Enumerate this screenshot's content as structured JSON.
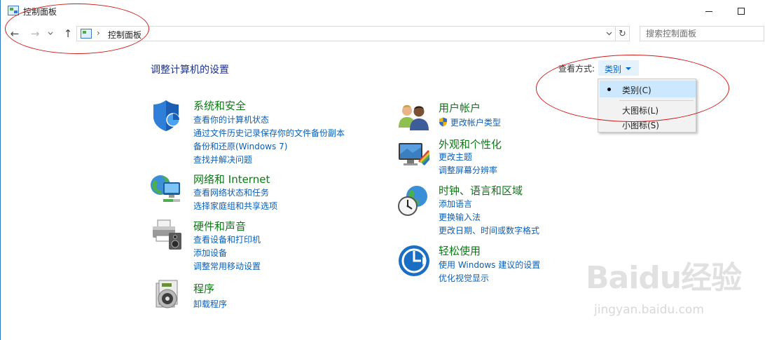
{
  "window": {
    "title": "控制面板"
  },
  "nav": {
    "back_icon": "←",
    "forward_icon": "→",
    "recent_icon": "⌄",
    "up_icon": "↑",
    "address_sep": "›",
    "address_text": "控制面板",
    "refresh_icon": "↻",
    "search_placeholder": "搜索控制面板"
  },
  "main": {
    "title": "调整计算机的设置",
    "view_by_label": "查看方式:",
    "view_by_value": "类别",
    "view_menu": [
      {
        "label": "类别(C)",
        "selected": true
      },
      {
        "label": "大图标(L)",
        "selected": false
      },
      {
        "label": "小图标(S)",
        "selected": false
      }
    ]
  },
  "categories": {
    "system": {
      "title": "系统和安全",
      "icon": "shield-icon",
      "links": [
        "查看你的计算机状态",
        "通过文件历史记录保存你的文件备份副本",
        "备份和还原(Windows 7)",
        "查找并解决问题"
      ]
    },
    "network": {
      "title": "网络和 Internet",
      "icon": "network-globe-icon",
      "links": [
        "查看网络状态和任务",
        "选择家庭组和共享选项"
      ]
    },
    "hardware": {
      "title": "硬件和声音",
      "icon": "printer-speaker-icon",
      "links": [
        "查看设备和打印机",
        "添加设备",
        "调整常用移动设置"
      ]
    },
    "programs": {
      "title": "程序",
      "icon": "programs-disc-icon",
      "links": [
        "卸载程序"
      ]
    },
    "users": {
      "title": "用户帐户",
      "icon": "users-icon",
      "links": [
        "更改帐户类型"
      ]
    },
    "appearance": {
      "title": "外观和个性化",
      "icon": "monitor-brush-icon",
      "links": [
        "更改主题",
        "调整屏幕分辨率"
      ]
    },
    "clock": {
      "title": "时钟、语言和区域",
      "icon": "clock-globe-icon",
      "links": [
        "添加语言",
        "更换输入法",
        "更改日期、时间或数字格式"
      ]
    },
    "ease": {
      "title": "轻松使用",
      "icon": "ease-of-access-icon",
      "links": [
        "使用 Windows 建议的设置",
        "优化视觉显示"
      ]
    }
  },
  "watermark": {
    "logo": "Baidu经验",
    "url": "jingyan.baidu.com"
  },
  "colors": {
    "category_title": "#0b7a14",
    "link": "#0b5fb4",
    "page_title": "#1e3287",
    "annotation": "#d11a1a",
    "menu_selected": "#cce8ff"
  }
}
